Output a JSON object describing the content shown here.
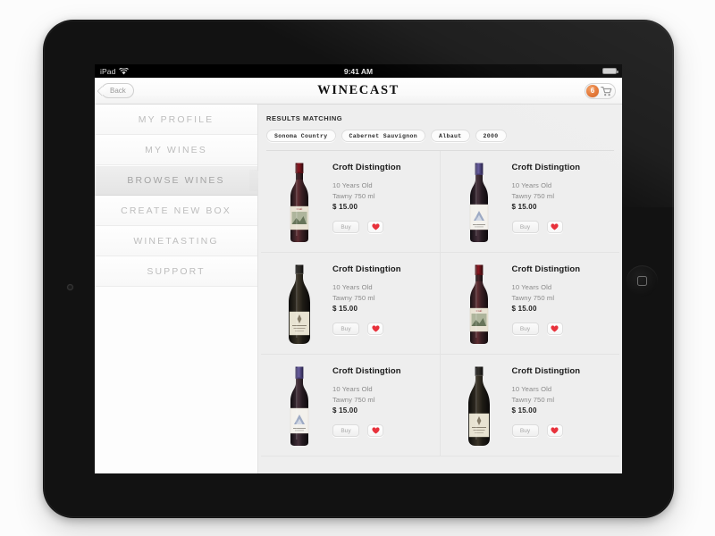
{
  "statusbar": {
    "carrier": "iPad",
    "time": "9:41 AM",
    "wifi_icon": "wifi-icon",
    "battery_icon": "battery-icon"
  },
  "navbar": {
    "back_label": "Back",
    "app_title": "WINECAST",
    "cart_count": "6",
    "cart_icon": "shopping-cart-icon"
  },
  "sidebar": {
    "items": [
      {
        "label": "MY PROFILE",
        "active": false
      },
      {
        "label": "MY WINES",
        "active": false
      },
      {
        "label": "BROWSE WINES",
        "active": true
      },
      {
        "label": "CREATE NEW BOX",
        "active": false
      },
      {
        "label": "WINETASTING",
        "active": false
      },
      {
        "label": "SUPPORT",
        "active": false
      }
    ]
  },
  "content": {
    "results_label": "RESULTS MATCHING",
    "filters": [
      {
        "label": "Sonoma Country"
      },
      {
        "label": "Cabernet Sauvignon"
      },
      {
        "label": "Albaut"
      },
      {
        "label": "2000"
      }
    ],
    "products": [
      {
        "title": "Croft Distingtion",
        "age": "10 Years Old",
        "variety": "Tawny 750 ml",
        "price": "$ 15.00",
        "buy_label": "Buy",
        "fav_icon": "heart-icon",
        "bottle": "bordeaux-red-capsule"
      },
      {
        "title": "Croft Distingtion",
        "age": "10 Years Old",
        "variety": "Tawny 750 ml",
        "price": "$ 15.00",
        "buy_label": "Buy",
        "fav_icon": "heart-icon",
        "bottle": "bordeaux-purple-capsule"
      },
      {
        "title": "Croft Distingtion",
        "age": "10 Years Old",
        "variety": "Tawny 750 ml",
        "price": "$ 15.00",
        "buy_label": "Buy",
        "fav_icon": "heart-icon",
        "bottle": "burgundy-cream-label"
      },
      {
        "title": "Croft Distingtion",
        "age": "10 Years Old",
        "variety": "Tawny 750 ml",
        "price": "$ 15.00",
        "buy_label": "Buy",
        "fav_icon": "heart-icon",
        "bottle": "bordeaux-red-capsule"
      },
      {
        "title": "Croft Distingtion",
        "age": "10 Years Old",
        "variety": "Tawny 750 ml",
        "price": "$ 15.00",
        "buy_label": "Buy",
        "fav_icon": "heart-icon",
        "bottle": "bordeaux-purple-capsule"
      },
      {
        "title": "Croft Distingtion",
        "age": "10 Years Old",
        "variety": "Tawny 750 ml",
        "price": "$ 15.00",
        "buy_label": "Buy",
        "fav_icon": "heart-icon",
        "bottle": "burgundy-cream-label"
      }
    ]
  },
  "device": {
    "home_button_icon": "home-button-icon",
    "camera_icon": "front-camera-icon"
  },
  "colors": {
    "badge_orange": "#e2702c",
    "heart_red": "#e8323c",
    "content_bg": "#eeeeee",
    "bezel": "#121212"
  }
}
